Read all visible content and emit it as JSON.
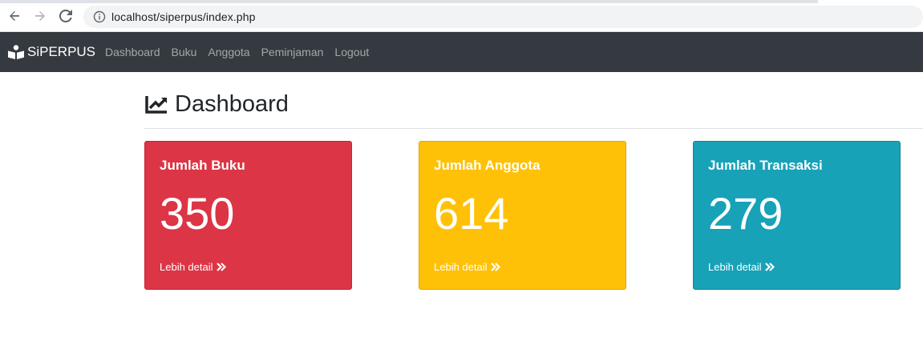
{
  "browser": {
    "url": "localhost/siperpus/index.php"
  },
  "navbar": {
    "brand": "SiPERPUS",
    "links": [
      "Dashboard",
      "Buku",
      "Anggota",
      "Peminjaman",
      "Logout"
    ]
  },
  "page": {
    "title": "Dashboard"
  },
  "cards": [
    {
      "title": "Jumlah Buku",
      "value": "350",
      "link": "Lebih detail",
      "color": "#dc3545"
    },
    {
      "title": "Jumlah Anggota",
      "value": "614",
      "link": "Lebih detail",
      "color": "#ffc107"
    },
    {
      "title": "Jumlah Transaksi",
      "value": "279",
      "link": "Lebih detail",
      "color": "#17a2b8"
    }
  ],
  "icons": {
    "brand": "book-reader-icon",
    "header": "chart-line-icon",
    "card_link": "double-chevron-right-icon"
  }
}
